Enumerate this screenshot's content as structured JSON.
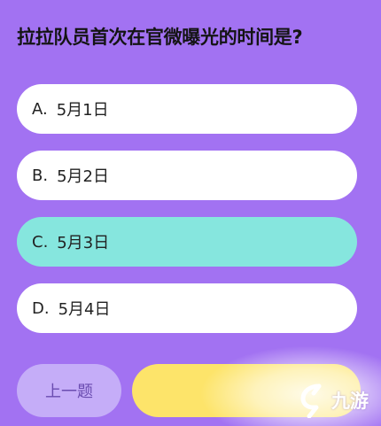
{
  "question": {
    "text": "拉拉队员首次在官微曝光的时间是?"
  },
  "options": [
    {
      "letter": "A.",
      "label": "5月1日",
      "selected": false
    },
    {
      "letter": "B.",
      "label": "5月2日",
      "selected": false
    },
    {
      "letter": "C.",
      "label": "5月3日",
      "selected": true
    },
    {
      "letter": "D.",
      "label": "5月4日",
      "selected": false
    }
  ],
  "navigation": {
    "prev_label": "上一题"
  },
  "watermark": {
    "text": "九游",
    "icon": "9you-logo-icon"
  },
  "colors": {
    "background": "#a272f2",
    "option_default": "#ffffff",
    "option_selected": "#86e6de",
    "prev_button": "#c5adf8",
    "next_button": "#fde46a"
  }
}
